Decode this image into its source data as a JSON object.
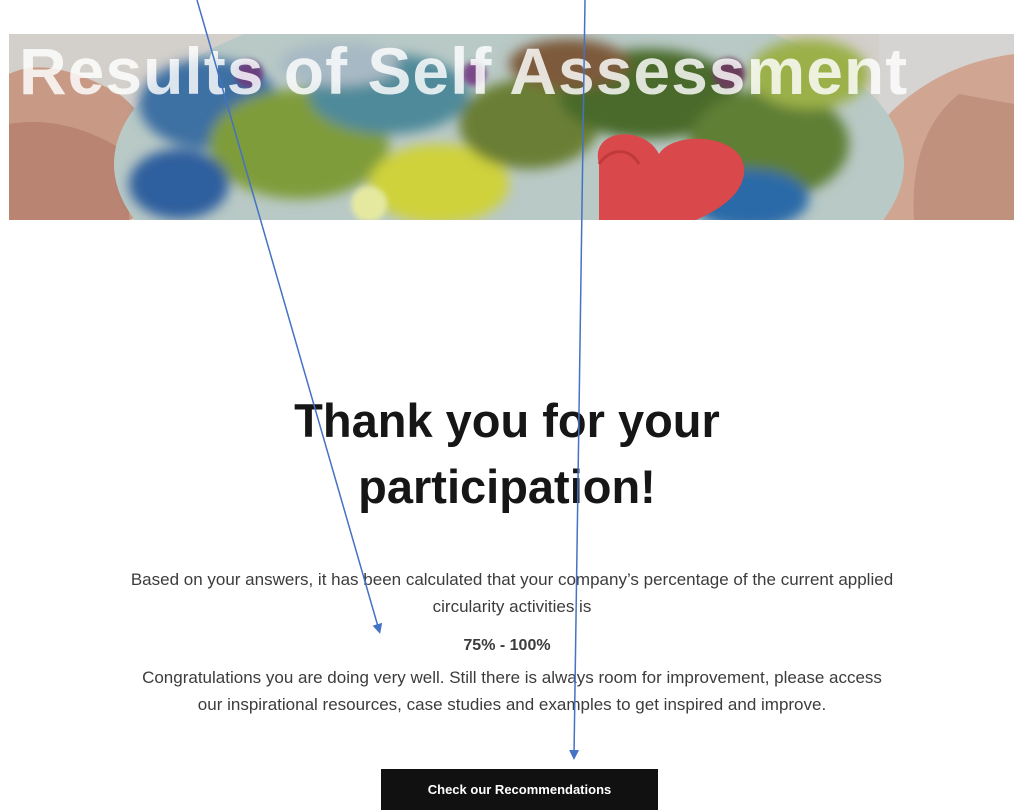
{
  "hero": {
    "title": "Results of Self Assessment"
  },
  "main": {
    "headline_line1": "Thank you for your",
    "headline_line2": "participation!",
    "intro_text": "Based on your answers, it has been calculated that your company’s percentage of the current applied circularity activities is",
    "result_range": "75% - 100%",
    "congrats_text": "Congratulations you are doing very well. Still there is always room for improvement, please access our inspirational resources, case studies and examples to get inspired and improve."
  },
  "cta": {
    "label": "Check our Recommendations"
  },
  "colors": {
    "annotation_arrow": "#4472c4",
    "button_bg": "#111111",
    "heart": "#d9484a"
  }
}
